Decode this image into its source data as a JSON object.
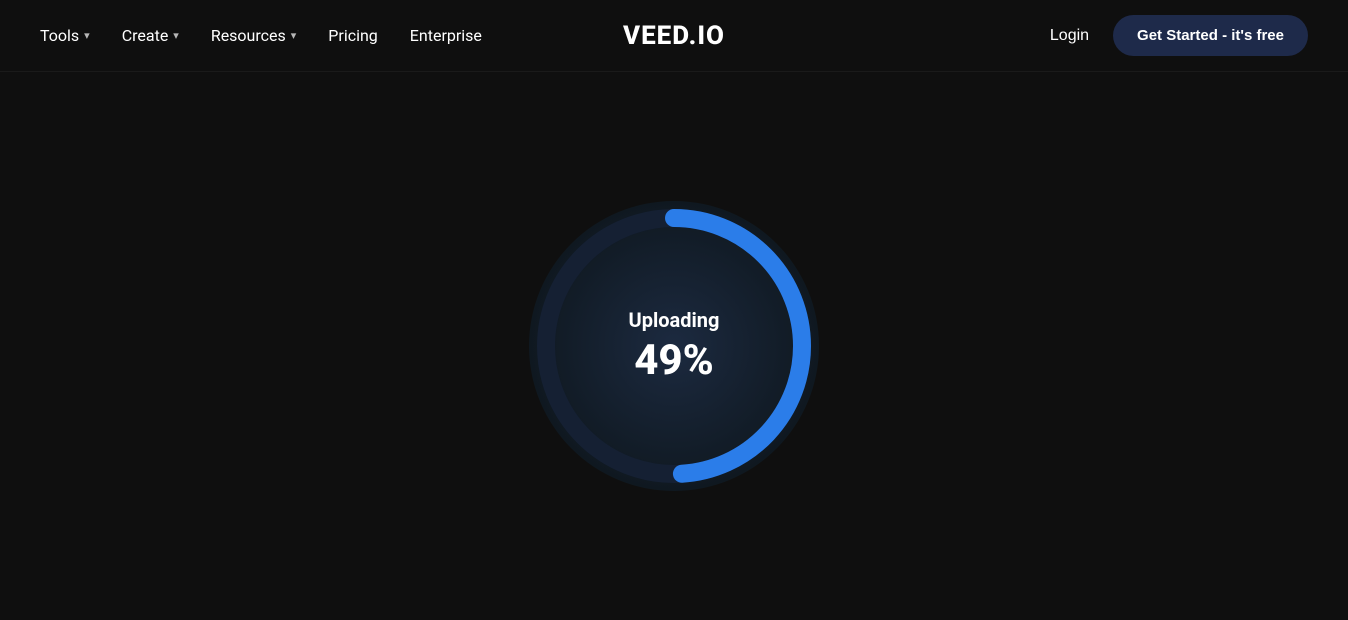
{
  "header": {
    "logo": "VEED.IO",
    "nav": {
      "tools_label": "Tools",
      "create_label": "Create",
      "resources_label": "Resources",
      "pricing_label": "Pricing",
      "enterprise_label": "Enterprise"
    },
    "login_label": "Login",
    "get_started_label": "Get Started - it's free"
  },
  "main": {
    "uploading_label": "Uploading",
    "percentage_label": "49%",
    "progress_value": 49,
    "colors": {
      "circle_bg": "#1a2235",
      "circle_track": "#152033",
      "circle_progress": "#2b7de9",
      "bg": "#0f0f0f"
    }
  }
}
